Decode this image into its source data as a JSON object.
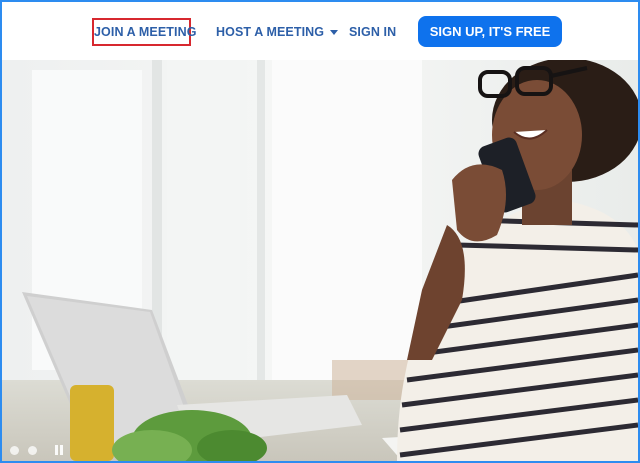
{
  "nav": {
    "join_label": "JOIN A MEETING",
    "host_label": "HOST A MEETING",
    "signin_label": "SIGN IN",
    "signup_label": "SIGN UP, IT'S FREE"
  },
  "icons": {
    "host_dropdown": "chevron-down-icon",
    "carousel_pause": "pause-icon"
  },
  "colors": {
    "nav_text": "#2d5fa8",
    "signup_bg": "#0e72ed",
    "highlight_border": "#d7282f",
    "frame_border": "#2d8cf0"
  }
}
